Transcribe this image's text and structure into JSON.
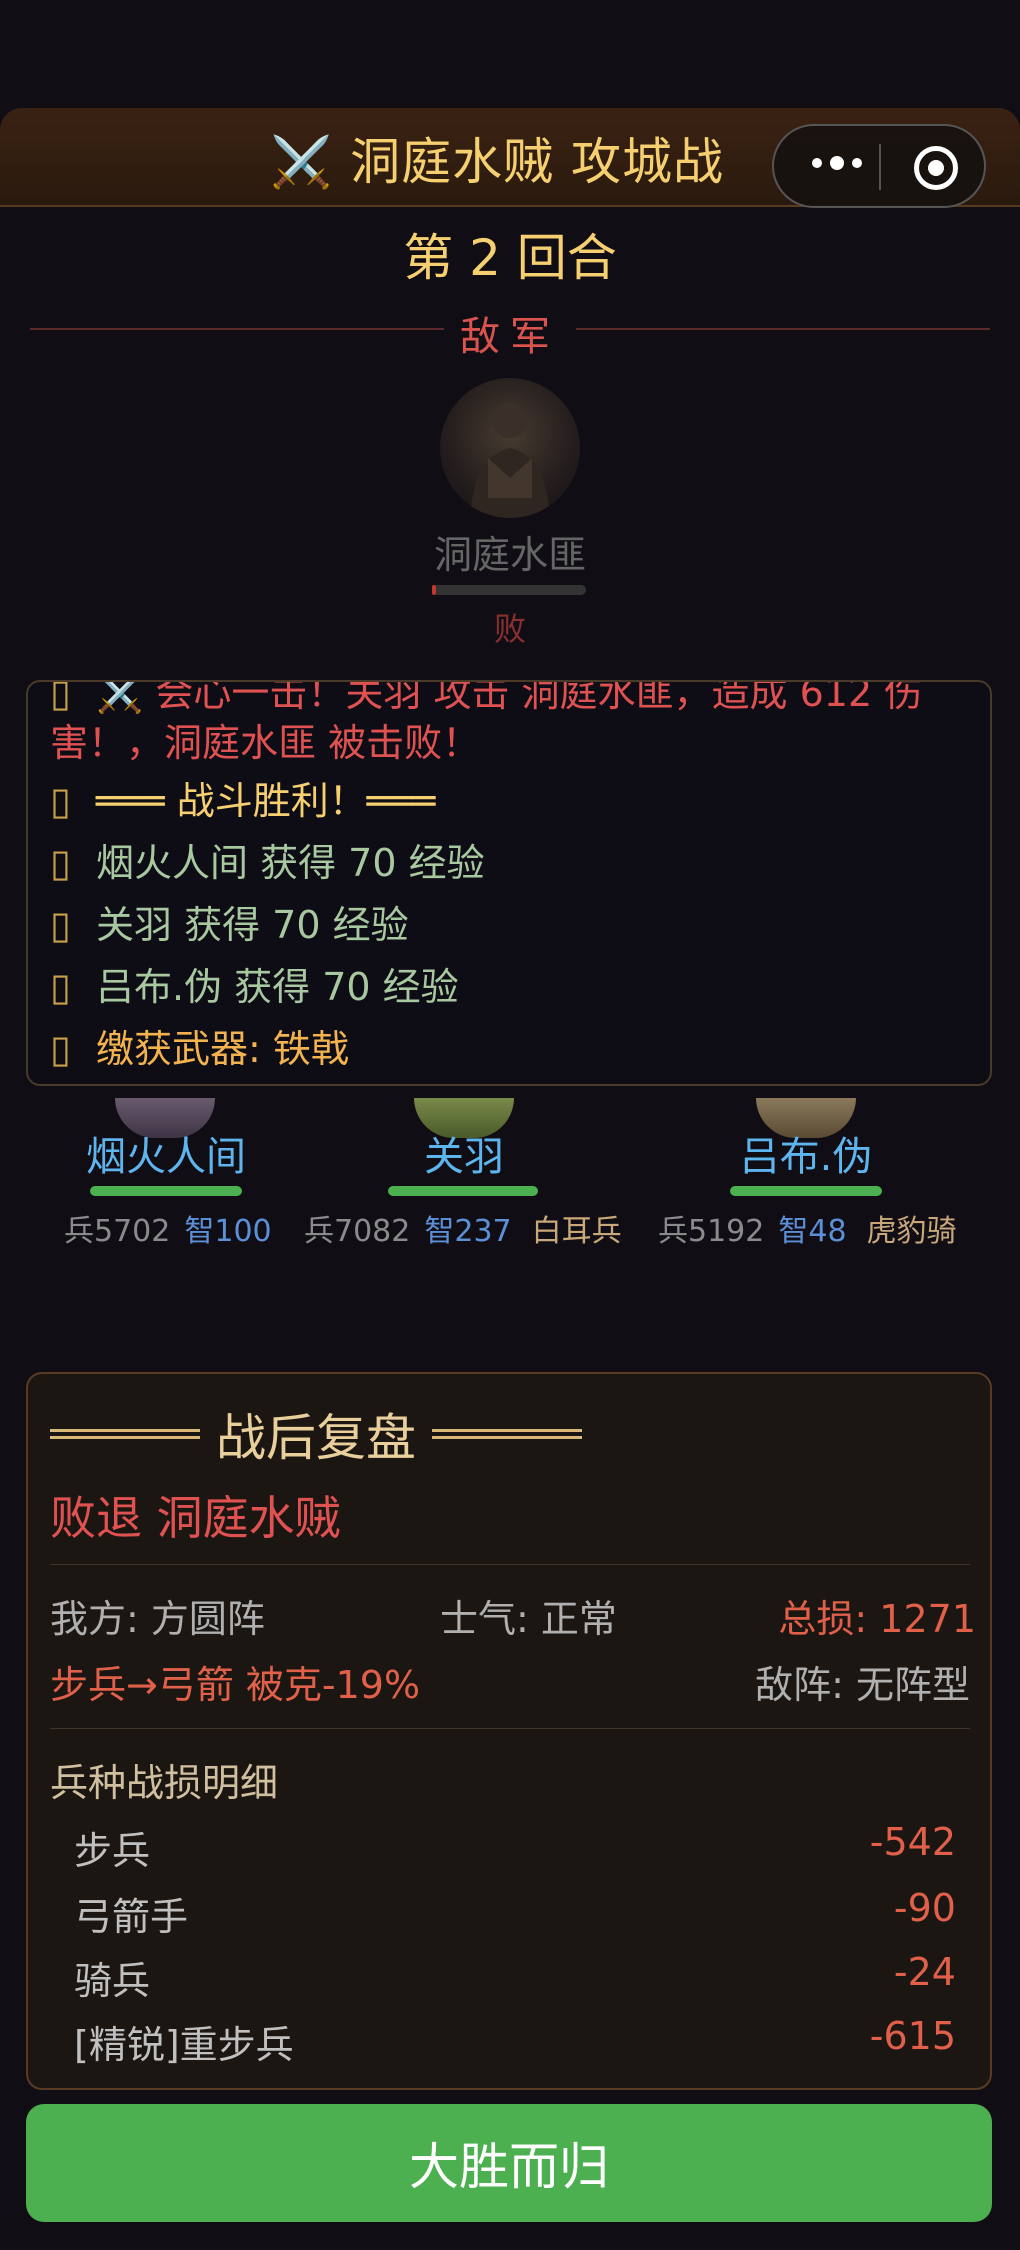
{
  "header": {
    "icon": "crossed-swords-icon",
    "title": "⚔️ 洞庭水贼 攻城战"
  },
  "round_label": "第 2 回合",
  "enemy": {
    "section_label": "敌军",
    "name": "洞庭水匪",
    "hp_fraction": 0.02,
    "status": "败"
  },
  "battle_log": [
    {
      "icon": "",
      "text": "⚔️ 会心一击！关羽 攻击 洞庭水匪，造成 612 伤",
      "color": "#e05252"
    },
    {
      "icon": "",
      "text": "害！，洞庭水匪 被击败！",
      "color": "#e05252"
    },
    {
      "icon": "",
      "text": "═══ 战斗胜利！═══",
      "color": "#f5cf70"
    },
    {
      "icon": "",
      "text": "烟火人间 获得 70 经验",
      "color": "#a8c8a0"
    },
    {
      "icon": "",
      "text": "关羽 获得 70 经验",
      "color": "#a8c8a0"
    },
    {
      "icon": "",
      "text": "吕布.伪 获得 70 经验",
      "color": "#a8c8a0"
    },
    {
      "icon": "",
      "text": "缴获武器: 铁戟",
      "color": "#f2b34f"
    }
  ],
  "heroes": [
    {
      "name": "烟火人间",
      "troops": "兵5702",
      "int": "智100",
      "type": ""
    },
    {
      "name": "关羽",
      "troops": "兵7082",
      "int": "智237",
      "type": "白耳兵"
    },
    {
      "name": "吕布.伪",
      "troops": "兵5192",
      "int": "智48",
      "type": "虎豹骑"
    }
  ],
  "review": {
    "title": "战后复盘",
    "result": "败退 洞庭水贼",
    "formation": "我方: 方圆阵",
    "morale": "士气: 正常",
    "total_loss": "总损: 1271",
    "counter": "步兵→弓箭 被克-19%",
    "enemy_formation": "敌阵: 无阵型",
    "detail_title": "兵种战损明细",
    "losses": [
      {
        "name": "步兵",
        "value": "-542"
      },
      {
        "name": "弓箭手",
        "value": "-90"
      },
      {
        "name": "骑兵",
        "value": "-24"
      },
      {
        "name": "[精锐]重步兵",
        "value": "-615"
      }
    ]
  },
  "finish_button": "大胜而归"
}
